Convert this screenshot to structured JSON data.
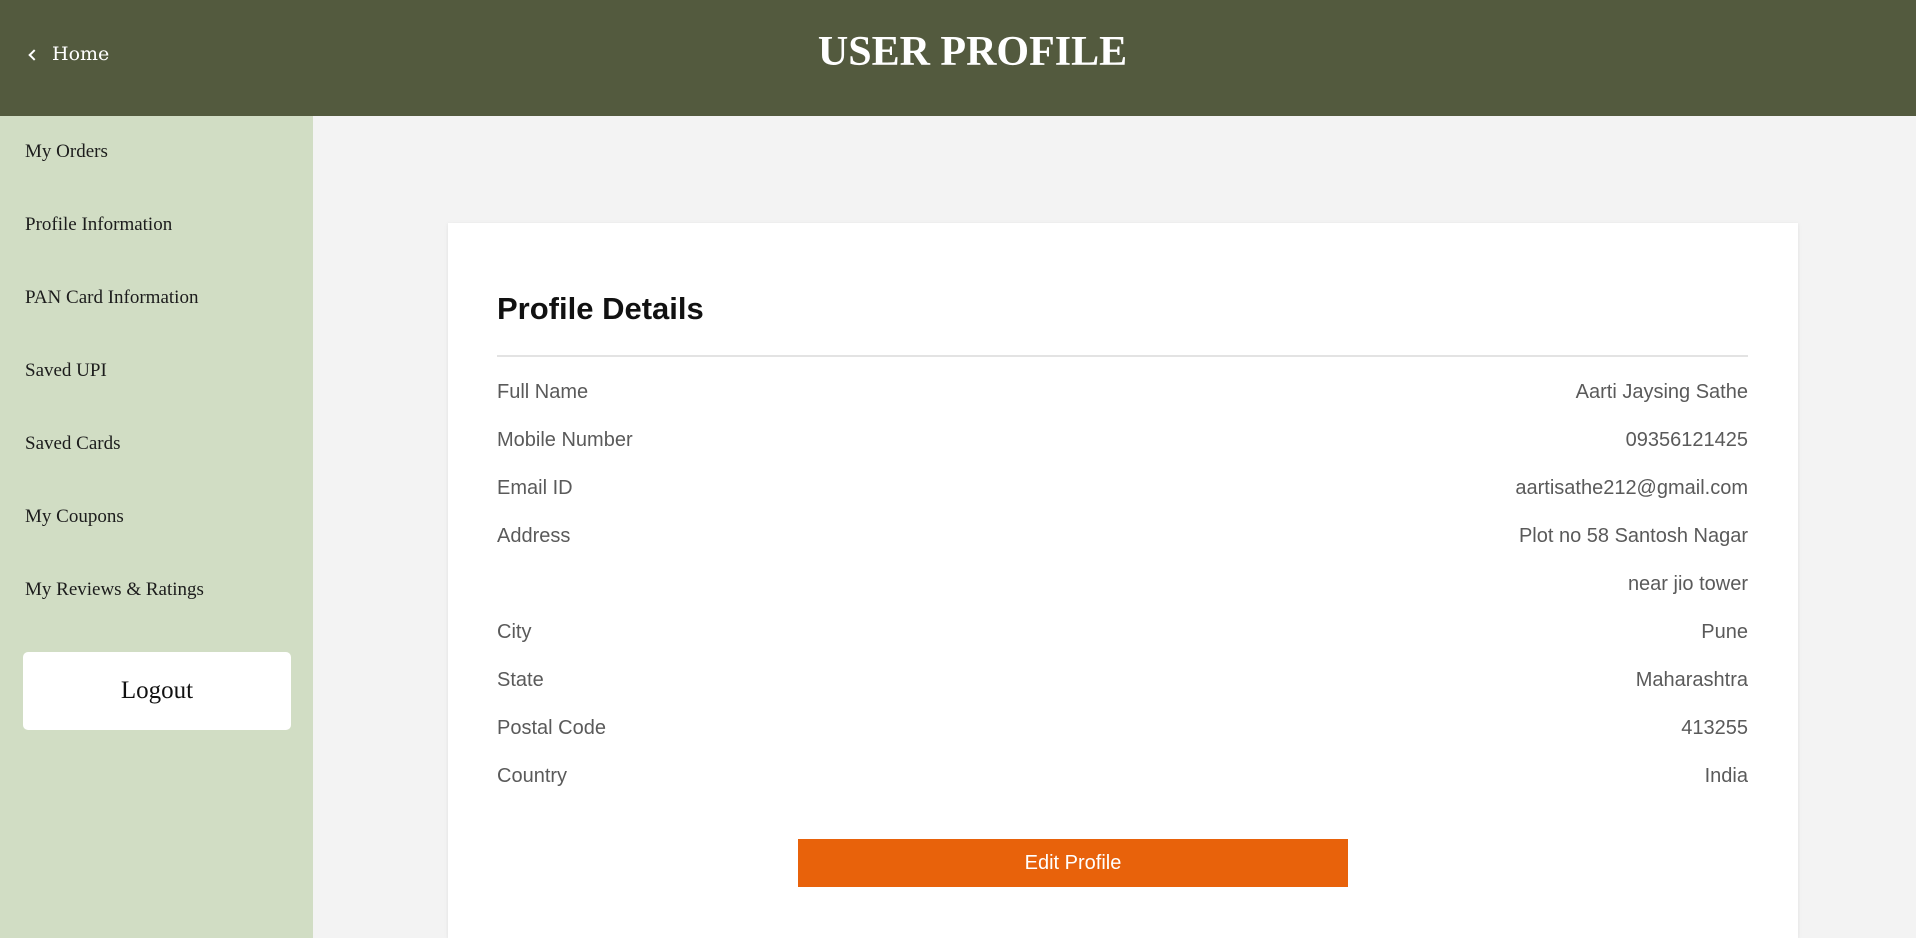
{
  "header": {
    "home_label": "Home",
    "title": "USER PROFILE"
  },
  "sidebar": {
    "items": [
      {
        "label": "My Orders"
      },
      {
        "label": "Profile Information"
      },
      {
        "label": "PAN Card Information"
      },
      {
        "label": "Saved UPI"
      },
      {
        "label": "Saved Cards"
      },
      {
        "label": "My Coupons"
      },
      {
        "label": "My Reviews & Ratings"
      }
    ],
    "logout_label": "Logout"
  },
  "profile": {
    "title": "Profile Details",
    "rows": [
      {
        "label": "Full Name",
        "value": "Aarti Jaysing Sathe"
      },
      {
        "label": "Mobile Number",
        "value": "09356121425"
      },
      {
        "label": "Email ID",
        "value": "aartisathe212@gmail.com"
      },
      {
        "label": "Address",
        "value": "Plot no 58 Santosh Nagar"
      },
      {
        "label": "",
        "value": "near jio tower"
      },
      {
        "label": "City",
        "value": "Pune"
      },
      {
        "label": "State",
        "value": "Maharashtra"
      },
      {
        "label": "Postal Code",
        "value": "413255"
      },
      {
        "label": "Country",
        "value": "India"
      }
    ],
    "edit_label": "Edit Profile"
  },
  "colors": {
    "header_bg": "#535a3e",
    "sidebar_bg": "#d1ddc4",
    "accent_button": "#e8620b",
    "page_bg": "#f3f3f3"
  },
  "icons": {
    "home": "chevron-left-icon"
  }
}
